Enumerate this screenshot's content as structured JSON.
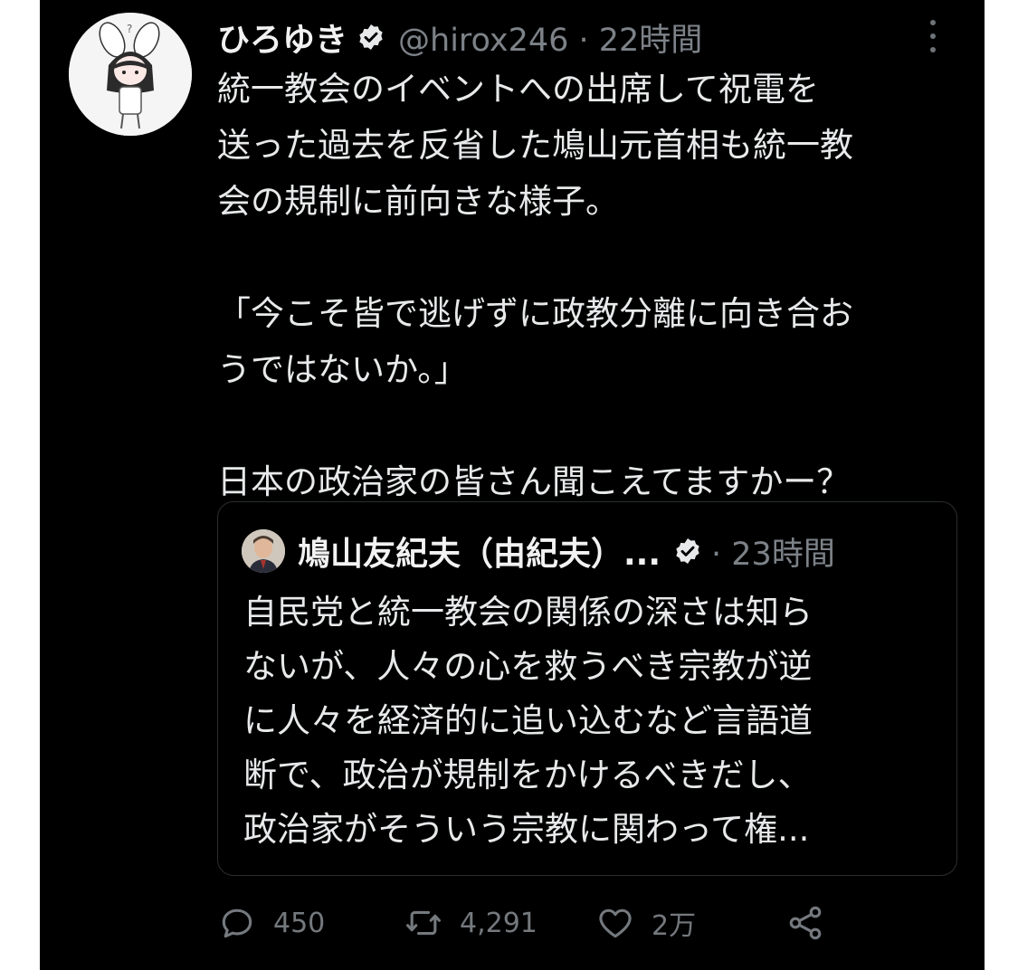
{
  "tweet": {
    "author_name": "ひろゆき",
    "handle_time": "@hirox246 · 22時間",
    "verified_icon": "verified-badge-icon",
    "body_lines": [
      "統一教会のイベントへの出席して祝電を",
      "送った過去を反省した鳩山元首相も統一教",
      "会の規制に前向きな様子。",
      "",
      "「今こそ皆で逃げずに政教分離に向き合お",
      "うではないか。」",
      "",
      "日本の政治家の皆さん聞こえてますかー？"
    ]
  },
  "quote": {
    "author_name": "鳩山友紀夫（由紀夫）...",
    "time": "· 23時間",
    "body_lines": [
      "自民党と統一教会の関係の深さは知ら",
      "ないが、人々の心を救うべき宗教が逆",
      "に人々を経済的に追い込むなど言語道",
      "断で、政治が規制をかけるべきだし、",
      "政治家がそういう宗教に関わって権..."
    ]
  },
  "actions": {
    "reply_count": "450",
    "retweet_count": "4,291",
    "like_count": "2万",
    "icons": [
      "reply-icon",
      "retweet-icon",
      "like-icon",
      "share-icon"
    ]
  },
  "colors": {
    "background": "#000000",
    "text": "#e7e9ea",
    "muted": "#7c8288"
  }
}
